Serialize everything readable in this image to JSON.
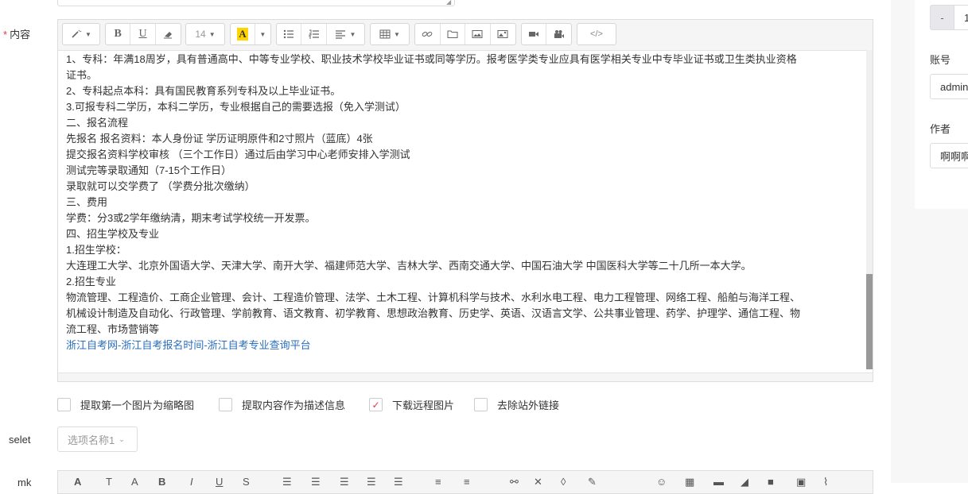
{
  "labels": {
    "content_star": "*",
    "content": "内容",
    "selet": "selet",
    "mk": "mk"
  },
  "toolbar": {
    "font_size": "14",
    "font_color_label": "A"
  },
  "content_lines": [
    "1、专科：年满18周岁，具有普通高中、中等专业学校、职业技术学校毕业证书或同等学历。报考医学类专业应具有医学相关专业中专毕业证书或卫生类执业资格",
    "证书。",
    "2、专科起点本科：具有国民教育系列专科及以上毕业证书。",
    "3.可报专科二学历，本科二学历，专业根据自己的需要选报（免入学测试）",
    "二、报名流程",
    "先报名 报名资料：本人身份证 学历证明原件和2寸照片（蓝底）4张",
    "提交报名资料学校审核 （三个工作日）通过后由学习中心老师安排入学测试",
    "测试完等录取通知（7-15个工作日）",
    "录取就可以交学费了 （学费分批次缴纳）",
    "三、费用",
    "学费：分3或2学年缴纳清，期末考试学校统一开发票。",
    "四、招生学校及专业",
    "1.招生学校：",
    "大连理工大学、北京外国语大学、天津大学、南开大学、福建师范大学、吉林大学、西南交通大学、中国石油大学 中国医科大学等二十几所一本大学。",
    "2.招生专业",
    "物流管理、工程造价、工商企业管理、会计、工程造价管理、法学、土木工程、计算机科学与技术、水利水电工程、电力工程管理、网络工程、船舶与海洋工程、",
    "机械设计制造及自动化、行政管理、学前教育、语文教育、初学教育、思想政治教育、历史学、英语、汉语言文学、公共事业管理、药学、护理学、通信工程、物",
    "流工程、市场营销等"
  ],
  "content_link": "浙江自考网-浙江自考报名时间-浙江自考专业查询平台",
  "options": [
    {
      "label": "提取第一个图片为缩略图",
      "checked": false
    },
    {
      "label": "提取内容作为描述信息",
      "checked": false
    },
    {
      "label": "下载远程图片",
      "checked": true
    },
    {
      "label": "去除站外链接",
      "checked": false
    }
  ],
  "select": {
    "value": "选项名称1"
  },
  "right_panel": {
    "minus": "-",
    "num_value": "1",
    "account_label": "账号",
    "account_value": "admin",
    "author_label": "作者",
    "author_value": "啊啊啊"
  }
}
